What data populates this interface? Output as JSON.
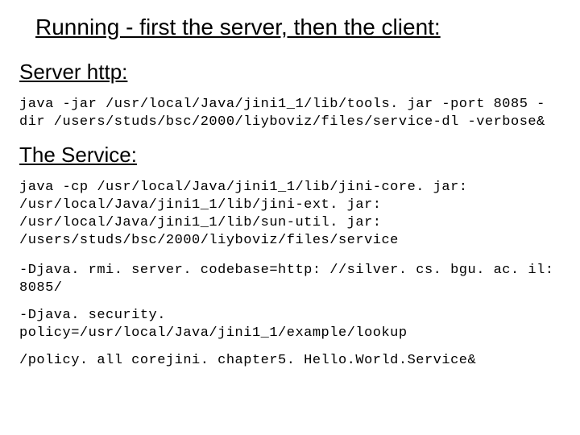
{
  "title": "Running - first the server, then the client:",
  "sections": {
    "server": {
      "heading": "Server http:",
      "command": "java -jar /usr/local/Java/jini1_1/lib/tools. jar -port 8085 -dir /users/studs/bsc/2000/liyboviz/files/service-dl -verbose&"
    },
    "service": {
      "heading": "The Service:",
      "command": "java -cp /usr/local/Java/jini1_1/lib/jini-core. jar: /usr/local/Java/jini1_1/lib/jini-ext. jar: /usr/local/Java/jini1_1/lib/sun-util. jar: /users/studs/bsc/2000/liyboviz/files/service",
      "options": [
        "-Djava. rmi. server. codebase=http: //silver. cs. bgu. ac. il: 8085/",
        "-Djava. security. policy=/usr/local/Java/jini1_1/example/lookup",
        "/policy. all corejini. chapter5. Hello.World.Service&"
      ]
    }
  }
}
